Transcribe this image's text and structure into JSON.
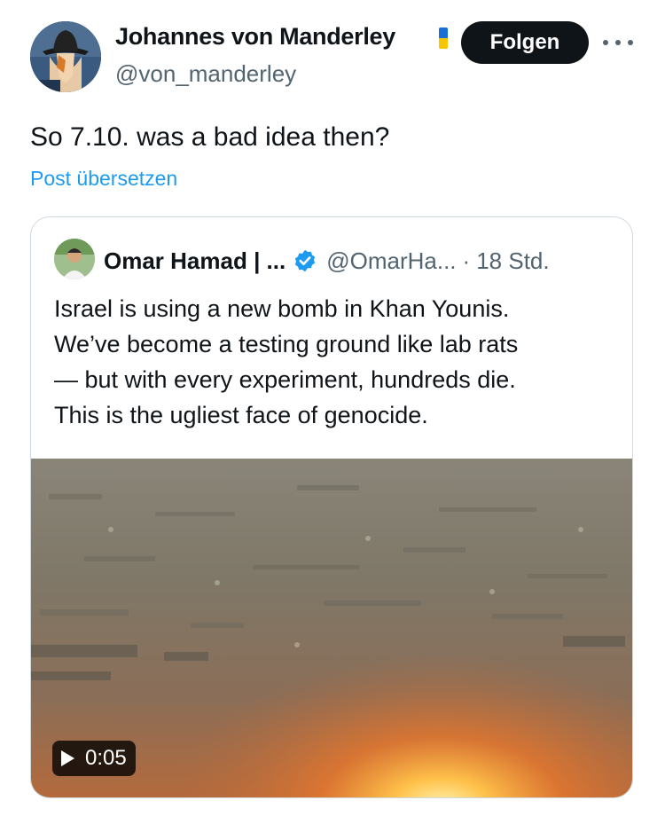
{
  "author": {
    "display_name": "Johannes von Manderley",
    "handle": "@von_manderley",
    "avatar_icon": "fedora-portrait-avatar",
    "badge_icon": "ukraine-flag-icon",
    "badge_colors": [
      "#1a6fd6",
      "#f7c600"
    ]
  },
  "actions": {
    "follow_label": "Folgen",
    "more_icon": "more-horizontal-icon"
  },
  "post": {
    "text": "So 7.10. was a bad idea then?",
    "translate_label": "Post übersetzen"
  },
  "quoted_post": {
    "display_name": "Omar Hamad | ...",
    "verified_icon": "verified-badge-icon",
    "verified_color": "#1d9bf0",
    "handle": "@OmarHa...",
    "separator": "·",
    "time": "18 Std.",
    "text_lines": [
      "Israel is using a new bomb in Khan Younis.",
      "We’ve become a testing ground like lab rats",
      "— but with every experiment, hundreds die.",
      "This is the ugliest face of genocide."
    ],
    "video": {
      "duration": "0:05",
      "play_icon": "play-icon"
    }
  },
  "colors": {
    "text_primary": "#0f1419",
    "text_secondary": "#536471",
    "link": "#1d9bf0",
    "border": "#cfd9de",
    "button_bg": "#0f1419"
  }
}
